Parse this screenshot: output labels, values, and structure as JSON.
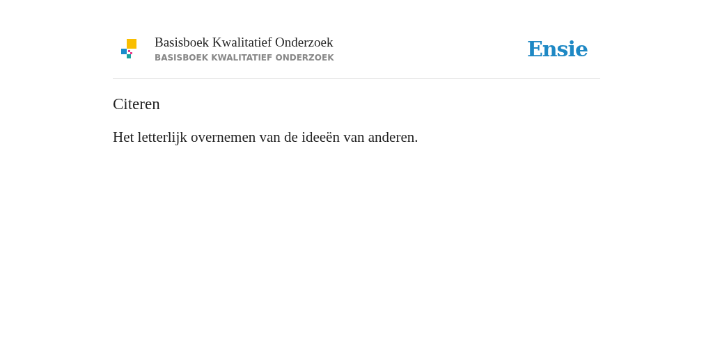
{
  "header": {
    "title": "Basisboek Kwalitatief Onderzoek",
    "subtitle": "BASISBOEK KWALITATIEF ONDERZOEK",
    "brand": "Ensie"
  },
  "entry": {
    "term": "Citeren",
    "definition": "Het letterlijk overnemen van de ideeën van anderen."
  }
}
